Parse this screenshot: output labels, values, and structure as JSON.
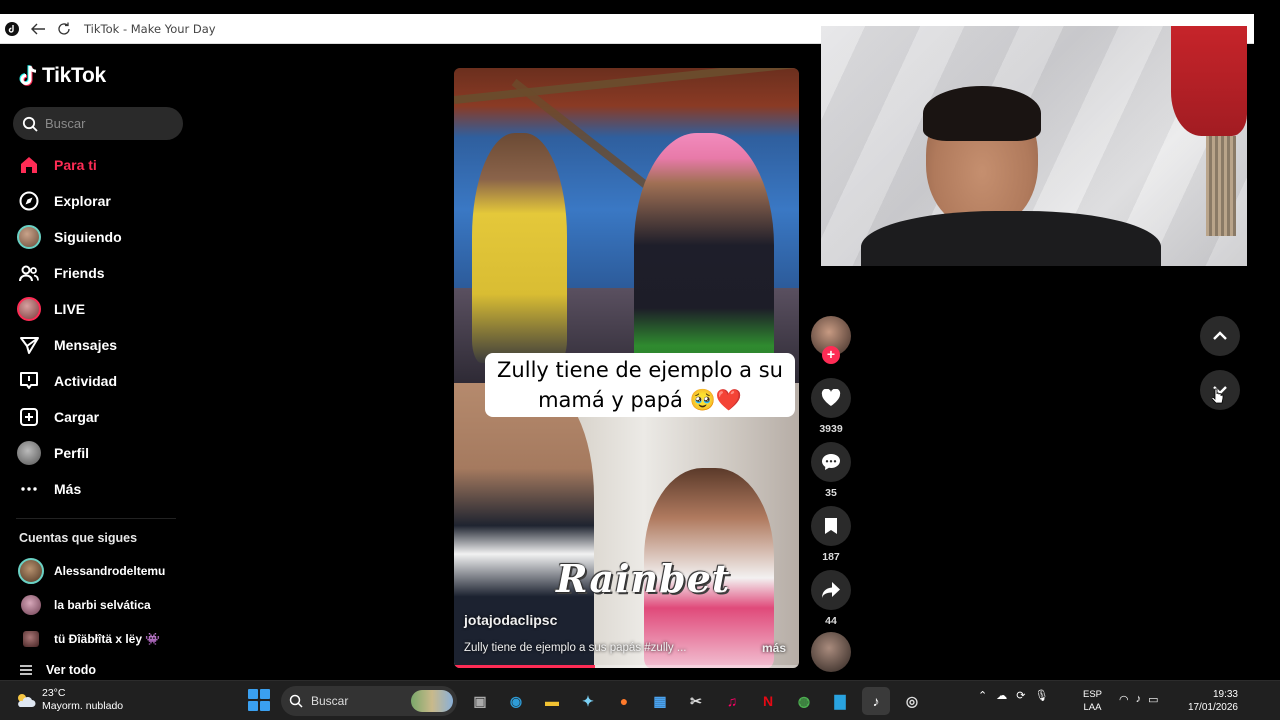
{
  "window": {
    "title": "TikTok - Make Your Day"
  },
  "sidebar": {
    "logo": "TikTok",
    "search_placeholder": "Buscar",
    "nav": [
      {
        "label": "Para ti",
        "icon": "home-icon",
        "active": true
      },
      {
        "label": "Explorar",
        "icon": "compass-icon"
      },
      {
        "label": "Siguiendo",
        "icon": "following-avatar"
      },
      {
        "label": "Friends",
        "icon": "friends-icon"
      },
      {
        "label": "LIVE",
        "icon": "live-avatar"
      },
      {
        "label": "Mensajes",
        "icon": "send-icon"
      },
      {
        "label": "Actividad",
        "icon": "activity-icon"
      },
      {
        "label": "Cargar",
        "icon": "upload-icon"
      },
      {
        "label": "Perfil",
        "icon": "profile-avatar"
      },
      {
        "label": "Más",
        "icon": "more-icon"
      }
    ],
    "following_title": "Cuentas que sigues",
    "following": [
      {
        "name": "Alessandrodeltemu"
      },
      {
        "name": "la barbi selvática"
      },
      {
        "name": "tü Ðîäbłîtä x lëy 👾"
      }
    ],
    "see_all": "Ver todo"
  },
  "video": {
    "caption_line1": "Zully tiene de ejemplo a su",
    "caption_line2": "mamá y papá 🥹❤️",
    "watermark": "Rainbet",
    "username": "jotajodaclipsc",
    "description": "Zully tiene de ejemplo a sus papás #zully ...",
    "more_label": "más",
    "progress": 0.41
  },
  "actions": {
    "likes": "3939",
    "comments": "35",
    "saves": "187",
    "shares": "44"
  },
  "taskbar": {
    "weather_temp": "23°C",
    "weather_desc": "Mayorm. nublado",
    "search_label": "Buscar",
    "lang_line1": "ESP",
    "lang_line2": "LAA",
    "time": "19:33",
    "date": "17/01/2026"
  },
  "colors": {
    "accent": "#fe2c55",
    "background": "#000000",
    "taskbar": "#202020"
  }
}
